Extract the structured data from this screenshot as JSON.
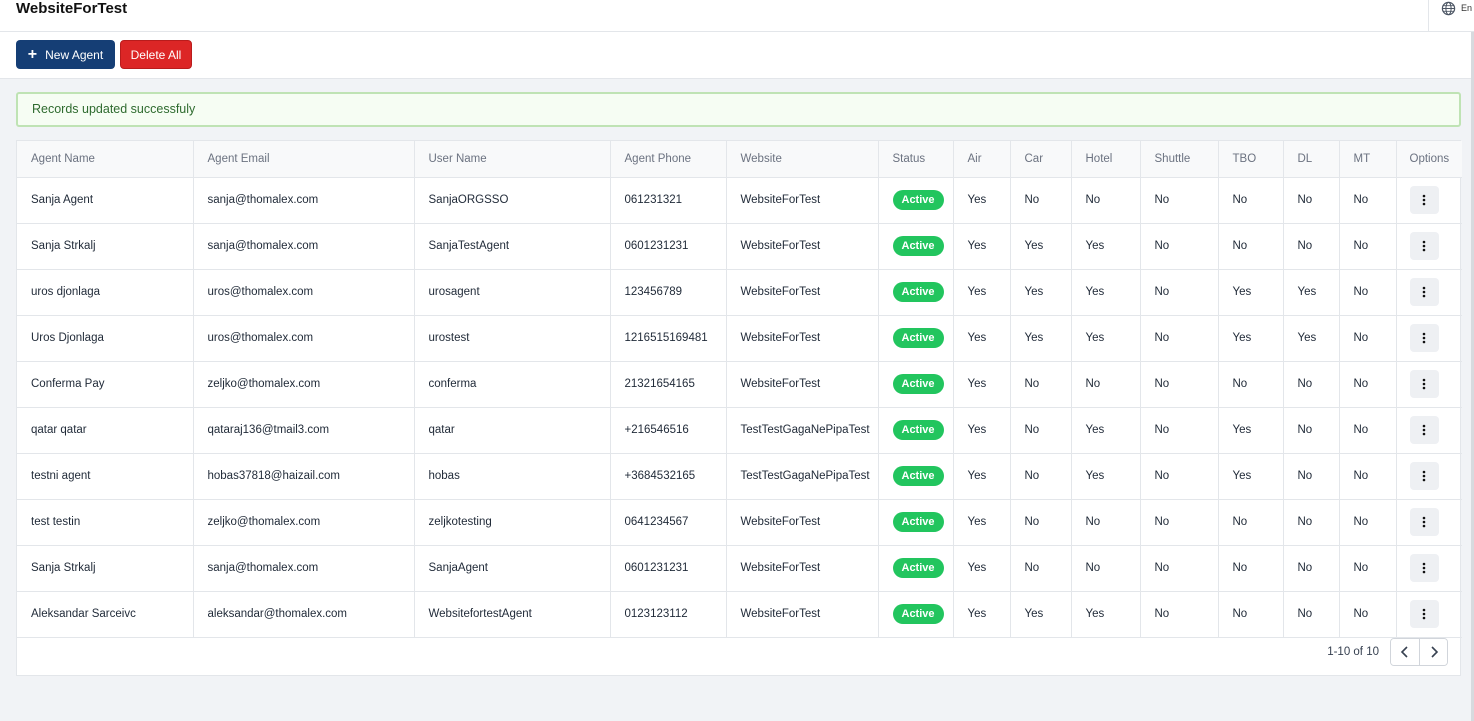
{
  "header": {
    "site_title": "WebsiteForTest",
    "language_icon": "globe-icon",
    "language_label": "En"
  },
  "toolbar": {
    "new_agent_label": "New Agent",
    "new_agent_icon": "plus-icon",
    "delete_all_label": "Delete All"
  },
  "alert": {
    "message": "Records updated successfuly"
  },
  "colors": {
    "primary": "#153e75",
    "danger": "#dc2626",
    "success": "#22c55e",
    "alert_bg": "#f6fdf3"
  },
  "table": {
    "columns": [
      "Agent Name",
      "Agent Email",
      "User Name",
      "Agent Phone",
      "Website",
      "Status",
      "Air",
      "Car",
      "Hotel",
      "Shuttle",
      "TBO",
      "DL",
      "MT",
      "Options"
    ],
    "rows": [
      [
        "Sanja Agent",
        "sanja@thomalex.com",
        "SanjaORGSSO",
        "061231321",
        "WebsiteForTest",
        "Active",
        "Yes",
        "No",
        "No",
        "No",
        "No",
        "No",
        "No"
      ],
      [
        "Sanja Strkalj",
        "sanja@thomalex.com",
        "SanjaTestAgent",
        "0601231231",
        "WebsiteForTest",
        "Active",
        "Yes",
        "Yes",
        "Yes",
        "No",
        "No",
        "No",
        "No"
      ],
      [
        "uros djonlaga",
        "uros@thomalex.com",
        "urosagent",
        "123456789",
        "WebsiteForTest",
        "Active",
        "Yes",
        "Yes",
        "Yes",
        "No",
        "Yes",
        "Yes",
        "No"
      ],
      [
        "Uros Djonlaga",
        "uros@thomalex.com",
        "urostest",
        "1216515169481",
        "WebsiteForTest",
        "Active",
        "Yes",
        "Yes",
        "Yes",
        "No",
        "Yes",
        "Yes",
        "No"
      ],
      [
        "Conferma Pay",
        "zeljko@thomalex.com",
        "conferma",
        "21321654165",
        "WebsiteForTest",
        "Active",
        "Yes",
        "No",
        "No",
        "No",
        "No",
        "No",
        "No"
      ],
      [
        "qatar qatar",
        "qataraj136@tmail3.com",
        "qatar",
        "+216546516",
        "TestTestGagaNePipaTest",
        "Active",
        "Yes",
        "No",
        "Yes",
        "No",
        "Yes",
        "No",
        "No"
      ],
      [
        "testni agent",
        "hobas37818@haizail.com",
        "hobas",
        "+3684532165",
        "TestTestGagaNePipaTest",
        "Active",
        "Yes",
        "No",
        "Yes",
        "No",
        "Yes",
        "No",
        "No"
      ],
      [
        "test testin",
        "zeljko@thomalex.com",
        "zeljkotesting",
        "0641234567",
        "WebsiteForTest",
        "Active",
        "Yes",
        "No",
        "No",
        "No",
        "No",
        "No",
        "No"
      ],
      [
        "Sanja Strkalj",
        "sanja@thomalex.com",
        "SanjaAgent",
        "0601231231",
        "WebsiteForTest",
        "Active",
        "Yes",
        "No",
        "No",
        "No",
        "No",
        "No",
        "No"
      ],
      [
        "Aleksandar Sarceivc",
        "aleksandar@thomalex.com",
        "WebsitefortestAgent",
        "0123123112",
        "WebsiteForTest",
        "Active",
        "Yes",
        "Yes",
        "Yes",
        "No",
        "No",
        "No",
        "No"
      ]
    ],
    "options_icon": "more-vertical-icon"
  },
  "pagination": {
    "range_text": "1-10 of 10",
    "prev_icon": "chevron-left-icon",
    "next_icon": "chevron-right-icon"
  }
}
